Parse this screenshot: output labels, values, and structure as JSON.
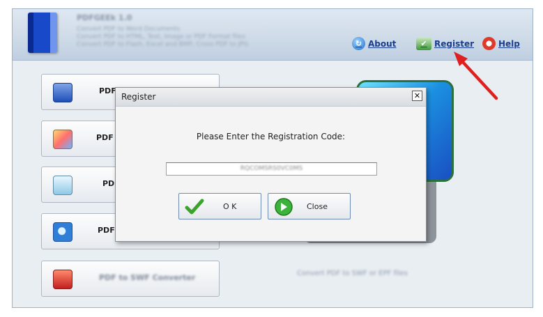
{
  "app": {
    "title": "PDFGEEk 1.0",
    "subtitle_lines": [
      "Convert PDF to Word Documents",
      "Convert PDF to HTML, Text, Image or PDF Format files",
      "Convert PDF to Flash, Excel and BMP, Cross PDF to JPG"
    ]
  },
  "toolbar": {
    "about_label": "About",
    "register_label": "Register",
    "help_label": "Help"
  },
  "side_buttons": [
    {
      "label": "PDF",
      "icon": "word-icon"
    },
    {
      "label": "PDF",
      "icon": "image-icon"
    },
    {
      "label": "PD",
      "icon": "text-doc-icon"
    },
    {
      "label": "PDF",
      "icon": "ie-html-icon"
    },
    {
      "label": "PDF to SWF Converter",
      "icon": "flash-icon"
    }
  ],
  "side_caption": "Convert PDF to SWF or EPF files",
  "dialog": {
    "title": "Register",
    "prompt": "Please Enter the Registration Code:",
    "code_value": "RQCOMSRS0VC0MS",
    "ok_label": "O K",
    "close_label": "Close"
  },
  "colors": {
    "accent_link": "#1a3f8f",
    "annotation_arrow": "#e02020"
  }
}
